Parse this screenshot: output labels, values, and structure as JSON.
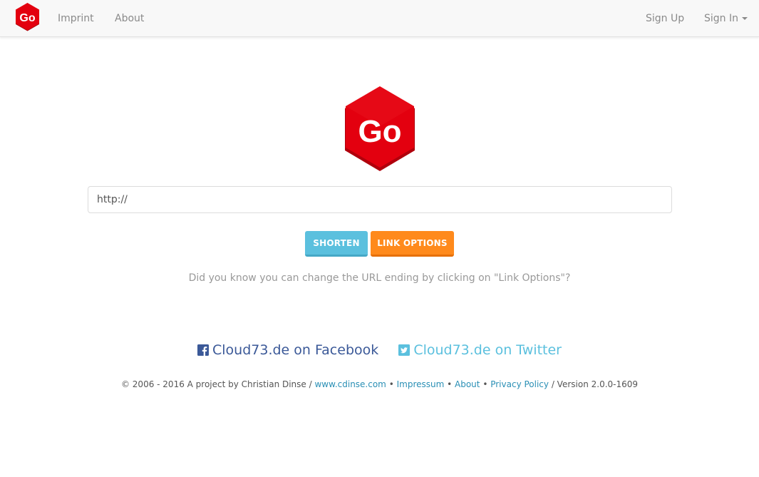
{
  "nav": {
    "brand_text": "Go",
    "imprint": "Imprint",
    "about": "About",
    "sign_up": "Sign Up",
    "sign_in": "Sign In"
  },
  "logo": {
    "text": "Go"
  },
  "form": {
    "url_value": "http://",
    "shorten_label": "SHORTEN",
    "options_label": "LINK OPTIONS"
  },
  "hint": "Did you know you can change the URL ending by clicking on \"Link Options\"?",
  "social": {
    "facebook": "Cloud73.de on Facebook",
    "twitter": "Cloud73.de on Twitter"
  },
  "footer": {
    "prefix": "© 2006 - 2016 A project by Christian Dinse / ",
    "site_link": "www.cdinse.com",
    "sep1": " • ",
    "impressum": "Impressum",
    "sep2": " • ",
    "about": "About",
    "sep3": " • ",
    "privacy": "Privacy Policy",
    "version": " / Version 2.0.0-1609"
  },
  "colors": {
    "brand_red": "#e3000f",
    "shorten_blue": "#5bc0de",
    "options_orange": "#ff8a1c",
    "facebook_blue": "#3b5998",
    "link_blue": "#2a8fb5"
  }
}
